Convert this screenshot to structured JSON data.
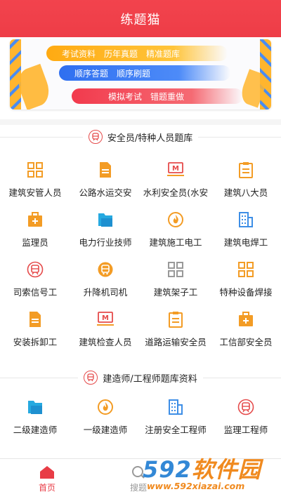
{
  "header": {
    "title": "练题猫"
  },
  "banner": {
    "row1": [
      "考试资料",
      "历年真题",
      "精准题库"
    ],
    "row2": [
      "顺序答题",
      "顺序刷题"
    ],
    "row3": [
      "模拟考试",
      "错题重做"
    ]
  },
  "section1": {
    "title": "安全员/特种人员题库",
    "items": [
      {
        "label": "建筑安管人员",
        "icon": "grid-icon"
      },
      {
        "label": "公路水运交安",
        "icon": "document-icon"
      },
      {
        "label": "水利安全员(水安",
        "icon": "m-card-icon"
      },
      {
        "label": "建筑八大员",
        "icon": "clipboard-icon"
      },
      {
        "label": "监理员",
        "icon": "medical-box-icon"
      },
      {
        "label": "电力行业技师",
        "icon": "folder-icon"
      },
      {
        "label": "建筑施工电工",
        "icon": "fire-icon"
      },
      {
        "label": "建筑电焊工",
        "icon": "building-icon"
      },
      {
        "label": "司索信号工",
        "icon": "train-icon"
      },
      {
        "label": "升降机司机",
        "icon": "bus-icon"
      },
      {
        "label": "建筑架子工",
        "icon": "grid-icon"
      },
      {
        "label": "特种设备焊接",
        "icon": "grid-icon"
      },
      {
        "label": "安装拆卸工",
        "icon": "document-icon"
      },
      {
        "label": "建筑检查人员",
        "icon": "m-card-icon"
      },
      {
        "label": "道路运输安全员",
        "icon": "clipboard-icon"
      },
      {
        "label": "工信部安全员",
        "icon": "medical-box-icon"
      }
    ]
  },
  "section2": {
    "title": "建造师/工程师题库资料",
    "items": [
      {
        "label": "二级建造师",
        "icon": "folder-icon"
      },
      {
        "label": "一级建造师",
        "icon": "fire-icon"
      },
      {
        "label": "注册安全工程师",
        "icon": "building-icon"
      },
      {
        "label": "监理工程师",
        "icon": "train-icon"
      }
    ]
  },
  "tabbar": {
    "home": "首页",
    "search": "搜题"
  },
  "watermark": {
    "brand_num": "592",
    "brand_txt": "软件园",
    "url": "www.592xiazai.com"
  },
  "colors": {
    "accent": "#ee3d47",
    "orange": "#f39c25",
    "blue": "#3d8ee6"
  }
}
